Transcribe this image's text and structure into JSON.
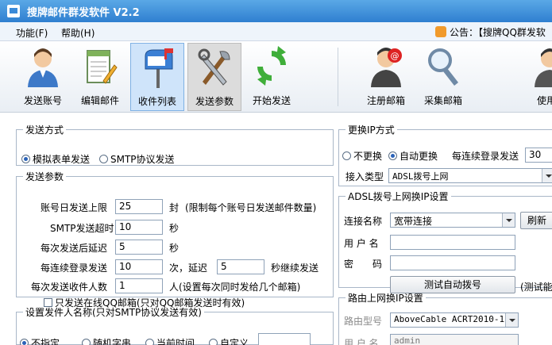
{
  "window": {
    "title": "搜牌邮件群发软件   V2.2"
  },
  "menu": {
    "items": [
      "功能(F)",
      "帮助(H)"
    ]
  },
  "notice": {
    "label": "公告：",
    "text": "【搜牌QQ群发软"
  },
  "toolbar": {
    "buttons": [
      {
        "label": "发送账号",
        "icon": "user-icon"
      },
      {
        "label": "编辑邮件",
        "icon": "notepad-edit-icon"
      },
      {
        "label": "收件列表",
        "icon": "mailbox-icon"
      },
      {
        "label": "发送参数",
        "icon": "tools-icon"
      },
      {
        "label": "开始发送",
        "icon": "refresh-icon"
      },
      {
        "label": "注册邮箱",
        "icon": "register-mail-icon"
      },
      {
        "label": "采集邮箱",
        "icon": "magnifier-icon"
      },
      {
        "label": "使用",
        "icon": "user-icon"
      }
    ]
  },
  "send_mode": {
    "legend": "发送方式",
    "options": [
      "模拟表单发送",
      "SMTP协议发送"
    ],
    "selected": "模拟表单发送"
  },
  "send_params": {
    "legend": "发送参数",
    "daily_limit": {
      "label": "账号日发送上限",
      "value": "25",
      "unit": "封",
      "note": "(限制每个账号日发送邮件数量)"
    },
    "smtp_timeout": {
      "label": "SMTP发送超时",
      "value": "10",
      "unit": "秒"
    },
    "delay_after_send": {
      "label": "每次发送后延迟",
      "value": "5",
      "unit": "秒"
    },
    "per_login": {
      "label": "每连续登录发送",
      "value": "10",
      "unit": "次，延迟",
      "delay_value": "5",
      "delay_unit": "秒继续发送"
    },
    "recipients_per_send": {
      "label": "每次发送收件人数",
      "value": "1",
      "unit": "人(设置每次同时发给几个邮箱)"
    },
    "qq_only": {
      "label": "只发送在线QQ邮箱(只对QQ邮箱发送时有效)",
      "checked": false
    }
  },
  "sender_name": {
    "legend": "设置发件人名称(只对SMTP协议发送有效)",
    "options": [
      "不指定",
      "随机字串",
      "当前时间",
      "自定义"
    ],
    "selected": "不指定",
    "custom_value": ""
  },
  "ip_mode": {
    "legend": "更换IP方式",
    "options": [
      "不更换",
      "自动更换"
    ],
    "selected": "自动更换",
    "per_login_label": "每连续登录发送",
    "per_login_value": "30",
    "access_type_label": "接入类型",
    "access_type_value": "ADSL拨号上网"
  },
  "adsl": {
    "legend": "ADSL拨号上网换IP设置",
    "conn_name_label": "连接名称",
    "conn_name_value": "宽带连接",
    "refresh_label": "刷新",
    "user_label": "用 户 名",
    "user_value": "",
    "password_label": "密　　码",
    "password_value": "",
    "test_button": "测试自动拨号",
    "test_hint": "(测试能"
  },
  "router": {
    "legend": "路由上网换IP设置",
    "model_label": "路由型号",
    "model_value": "AboveCable  ACRT2010-1",
    "user_label": "用 户 名",
    "user_value": "admin"
  }
}
